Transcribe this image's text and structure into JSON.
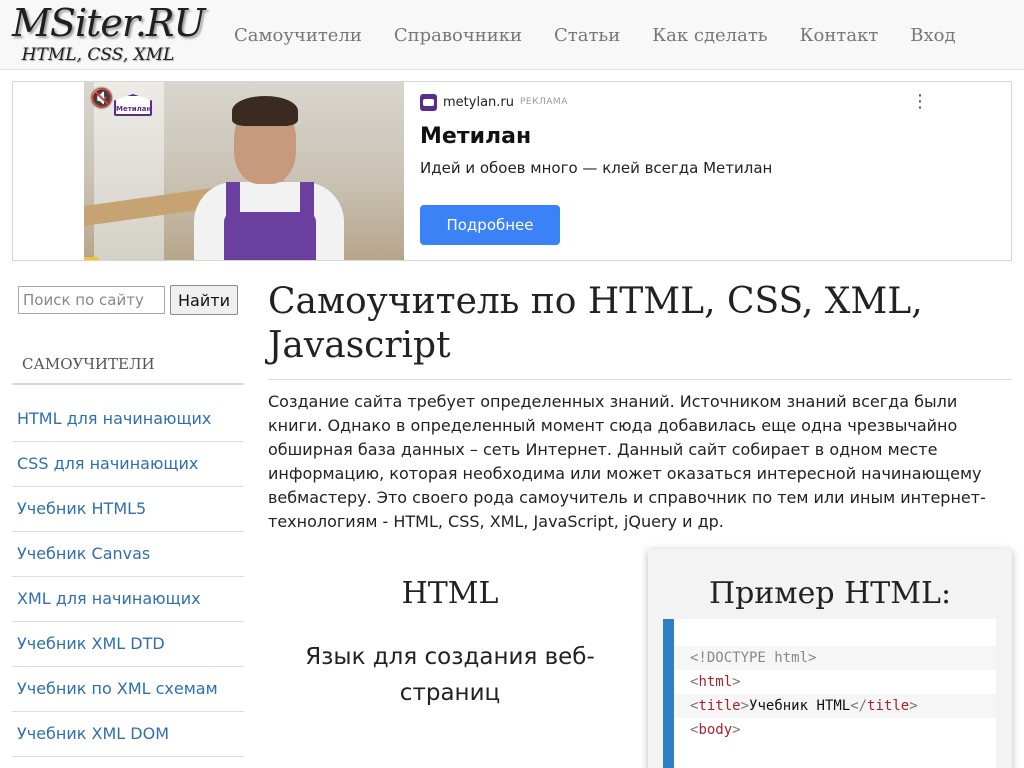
{
  "header": {
    "logo_main": "MSiter.RU",
    "logo_sub": "HTML, CSS, XML",
    "nav": [
      "Самоучители",
      "Справочники",
      "Статьи",
      "Как сделать",
      "Контакт",
      "Вход"
    ]
  },
  "ad": {
    "brand_badge": "Метилан",
    "domain": "metylan.ru",
    "label": "РЕКЛАМА",
    "title": "Метилан",
    "text": "Идей и обоев много — клей всегда Метилан",
    "button": "Подробнее",
    "icons": {
      "mute": "volume-muted-icon",
      "menu": "more-vertical-icon"
    },
    "colors": {
      "button": "#3b82f6",
      "brand": "#5a2d8c"
    }
  },
  "sidebar": {
    "search_placeholder": "Поиск по сайту",
    "search_button": "Найти",
    "heading": "САМОУЧИТЕЛИ",
    "items": [
      "HTML для начинающих",
      "CSS для начинающих",
      "Учебник HTML5",
      "Учебник Canvas",
      "XML для начинающих",
      "Учебник XML DTD",
      "Учебник по XML схемам",
      "Учебник XML DOM"
    ]
  },
  "main": {
    "title": "Самоучитель по HTML, CSS, XML, Javascript",
    "intro": "Создание сайта требует определенных знаний. Источником знаний всегда были книги. Однако в определенный момент сюда добавилась еще одна чрезвычайно обширная база данных – сеть Интернет. Данный сайт собирает в одном месте информацию, которая необходима или может оказаться интересной начинающему вебмастеру. Это своего рода самоучитель и справочник по тем или иным интернет-технологиям - HTML, CSS, XML, JavaScript, jQuery и др.",
    "html_heading": "HTML",
    "html_sub": "Язык для создания веб-страниц",
    "example_title": "Пример HTML:",
    "code": {
      "line1": "<!DOCTYPE html>",
      "lt": "<",
      "gt": ">",
      "lt_slash": "</",
      "tag_html": "html",
      "tag_title": "title",
      "title_text": "Учебник HTML",
      "tag_body": "body"
    }
  }
}
